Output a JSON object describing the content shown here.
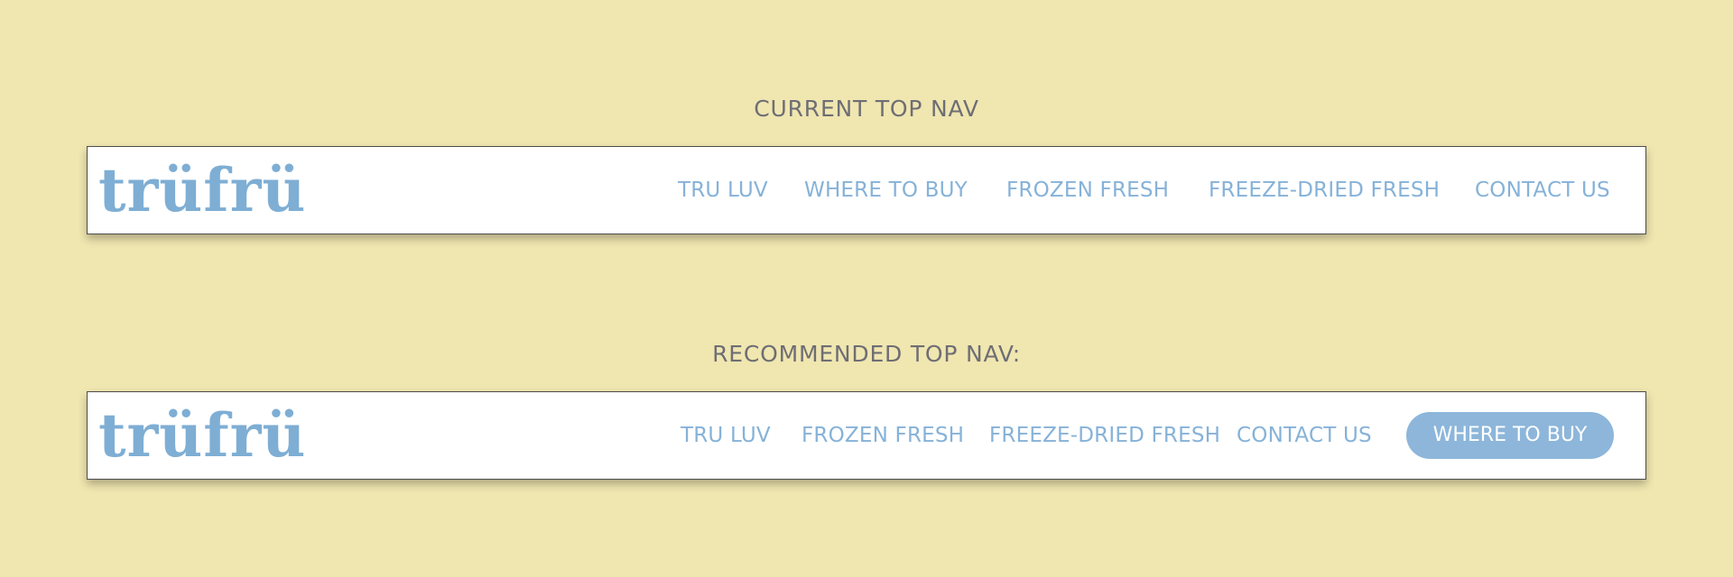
{
  "colors": {
    "background": "#f0e6b0",
    "brand_blue": "#7eaed4",
    "link_blue": "#86b2d8",
    "cta_background": "#8db6da",
    "heading_gray": "#6e6e74"
  },
  "current": {
    "heading": "CURRENT TOP NAV",
    "logo": "trüfrü",
    "links": [
      "TRU LUV",
      "WHERE TO BUY",
      "FROZEN FRESH",
      "FREEZE-DRIED FRESH",
      "CONTACT US"
    ]
  },
  "recommended": {
    "heading": "RECOMMENDED TOP NAV:",
    "logo": "trüfrü",
    "links": [
      "TRU LUV",
      "FROZEN FRESH",
      "FREEZE-DRIED FRESH",
      "CONTACT US"
    ],
    "cta_label": "WHERE TO BUY"
  }
}
